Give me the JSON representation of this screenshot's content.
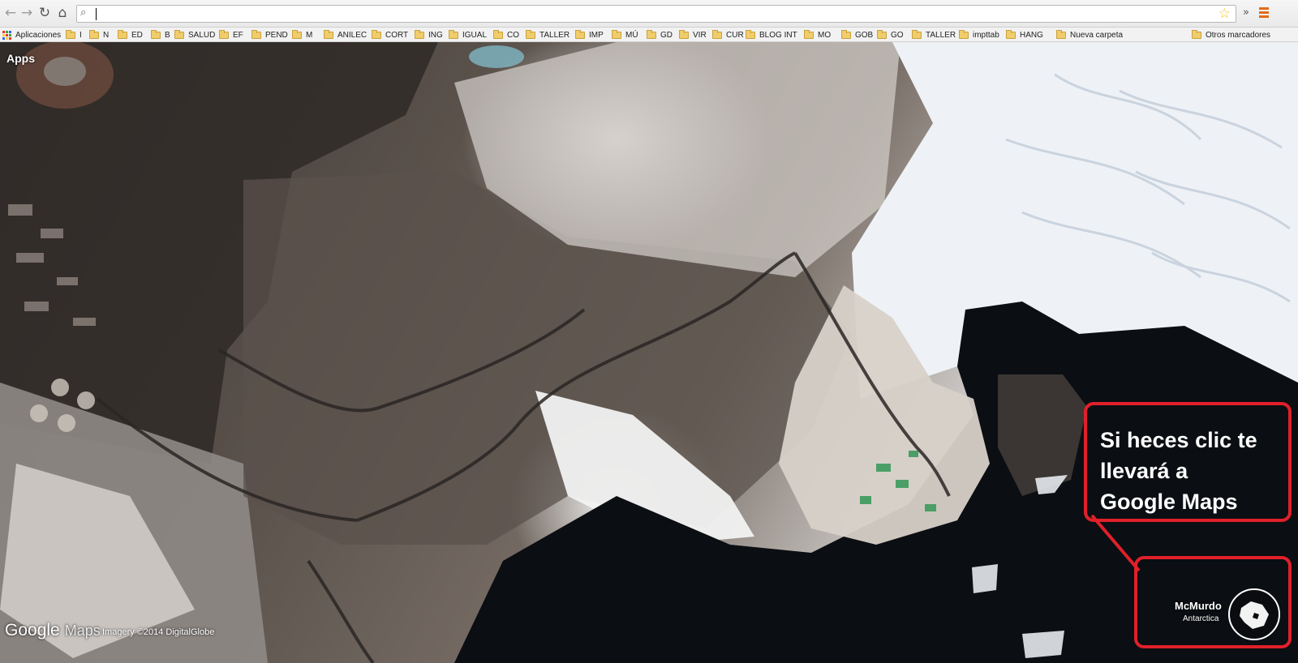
{
  "toolbar": {
    "back_icon": "back-arrow-icon",
    "forward_icon": "forward-arrow-icon",
    "reload_icon": "reload-icon",
    "home_icon": "home-icon",
    "omnibox_value": "",
    "bookmark_star_icon": "star-icon",
    "overflow_icon": "chevron-right-icon",
    "menu_icon": "menu-icon"
  },
  "bookmarks": {
    "apps_label": "Aplicaciones",
    "items": [
      "I",
      "N",
      "ED",
      "B",
      "SALUD",
      "EF",
      "PEND",
      "M",
      "ANILEC",
      "CORT",
      "ING",
      "IGUAL",
      "CO",
      "TALLER",
      "IMP",
      "MÚ",
      "GD",
      "VIR",
      "CUR",
      "BLOG INT",
      "MO",
      "GOB",
      "GO",
      "TALLER",
      "impttab",
      "HANG",
      "Nueva carpeta"
    ],
    "other_label": "Otros marcadores"
  },
  "map": {
    "apps_link": "Apps",
    "logo_google": "Google",
    "logo_maps": "Maps",
    "imagery_credit": "Imagery ©2014 DigitalGlobe",
    "location_name": "McMurdo",
    "location_region": "Antarctica",
    "callout_text": "Si heces clic te\nllevará a\nGoogle Maps",
    "callout_color": "#e0202a"
  }
}
